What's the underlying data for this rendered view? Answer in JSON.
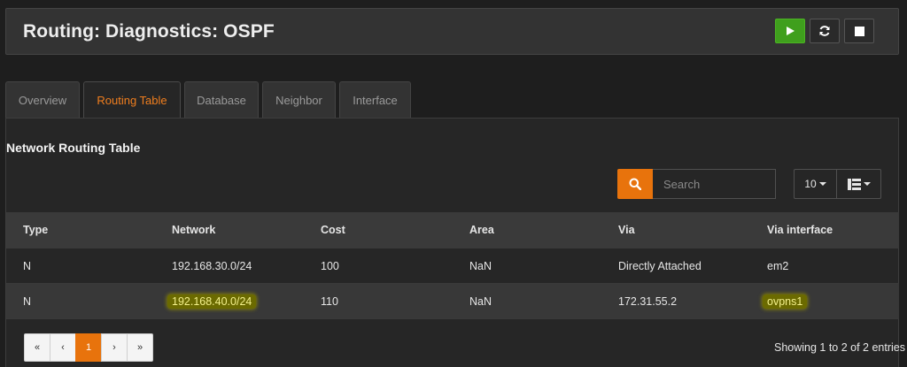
{
  "header": {
    "title": "Routing: Diagnostics: OSPF"
  },
  "tabs": [
    {
      "label": "Overview"
    },
    {
      "label": "Routing Table",
      "active": true
    },
    {
      "label": "Database"
    },
    {
      "label": "Neighbor"
    },
    {
      "label": "Interface"
    }
  ],
  "panel": {
    "title": "Network Routing Table"
  },
  "search": {
    "placeholder": "Search"
  },
  "page_size": "10",
  "table": {
    "columns": [
      "Type",
      "Network",
      "Cost",
      "Area",
      "Via",
      "Via interface"
    ],
    "rows": [
      [
        "N",
        "192.168.30.0/24",
        "100",
        "NaN",
        "Directly Attached",
        "em2"
      ],
      [
        "N",
        "192.168.40.0/24",
        "110",
        "NaN",
        "172.31.55.2",
        "ovpns1"
      ]
    ]
  },
  "pagination": {
    "first": "«",
    "prev": "‹",
    "current": "1",
    "next": "›",
    "last": "»"
  },
  "info": "Showing 1 to 2 of 2 entries",
  "icons": {
    "play": "play-icon",
    "refresh": "refresh-icon",
    "stop": "stop-icon",
    "search": "search-icon",
    "columns": "column-selector-icon"
  },
  "colors": {
    "accent": "#e8730c",
    "play": "#3f9f1d",
    "highlight": "#6b6a00"
  }
}
